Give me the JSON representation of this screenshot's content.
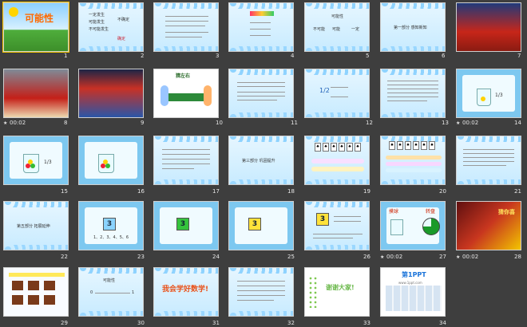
{
  "slides": [
    {
      "num": "1",
      "title": "可能性"
    },
    {
      "num": "2",
      "lines": [
        "一定发生",
        "可能发生",
        "不可能发生",
        "不确定",
        "确定"
      ]
    },
    {
      "num": "3"
    },
    {
      "num": "4"
    },
    {
      "num": "5",
      "title": "可能性",
      "labels": [
        "不可能",
        "可能",
        "一定"
      ]
    },
    {
      "num": "6",
      "heading": "第一部分 感知新知"
    },
    {
      "num": "7"
    },
    {
      "num": "8",
      "timer": "00:02"
    },
    {
      "num": "9"
    },
    {
      "num": "10",
      "heading": "猜左右"
    },
    {
      "num": "11"
    },
    {
      "num": "12",
      "fraction": "1/2"
    },
    {
      "num": "13"
    },
    {
      "num": "14",
      "timer": "00:02",
      "fraction": "1/3"
    },
    {
      "num": "15",
      "fraction": "1/3"
    },
    {
      "num": "16"
    },
    {
      "num": "17"
    },
    {
      "num": "18",
      "heading": "第三部分 巩固提升"
    },
    {
      "num": "19"
    },
    {
      "num": "20"
    },
    {
      "num": "21"
    },
    {
      "num": "22",
      "heading": "第五部分 拓展延伸"
    },
    {
      "num": "23",
      "cube": "3",
      "dice": "1、2、3、4、5、6"
    },
    {
      "num": "24",
      "cube": "3"
    },
    {
      "num": "25",
      "cube": "3"
    },
    {
      "num": "26",
      "cube": "3"
    },
    {
      "num": "27",
      "timer": "00:02",
      "label_a": "摸球",
      "label_b": "转盘"
    },
    {
      "num": "28",
      "timer": "00:02",
      "label_a": "猜你喜"
    },
    {
      "num": "29"
    },
    {
      "num": "30",
      "title": "可能性",
      "labels": [
        "0",
        "1"
      ]
    },
    {
      "num": "31",
      "text": "我会学好数学!"
    },
    {
      "num": "32"
    },
    {
      "num": "33",
      "text": "谢谢大家!"
    },
    {
      "num": "34",
      "brand": "第1PPT",
      "url": "www.1ppt.com"
    }
  ],
  "colors": {
    "background": "#3e3e3e",
    "selected_outline": "#f3c400"
  }
}
